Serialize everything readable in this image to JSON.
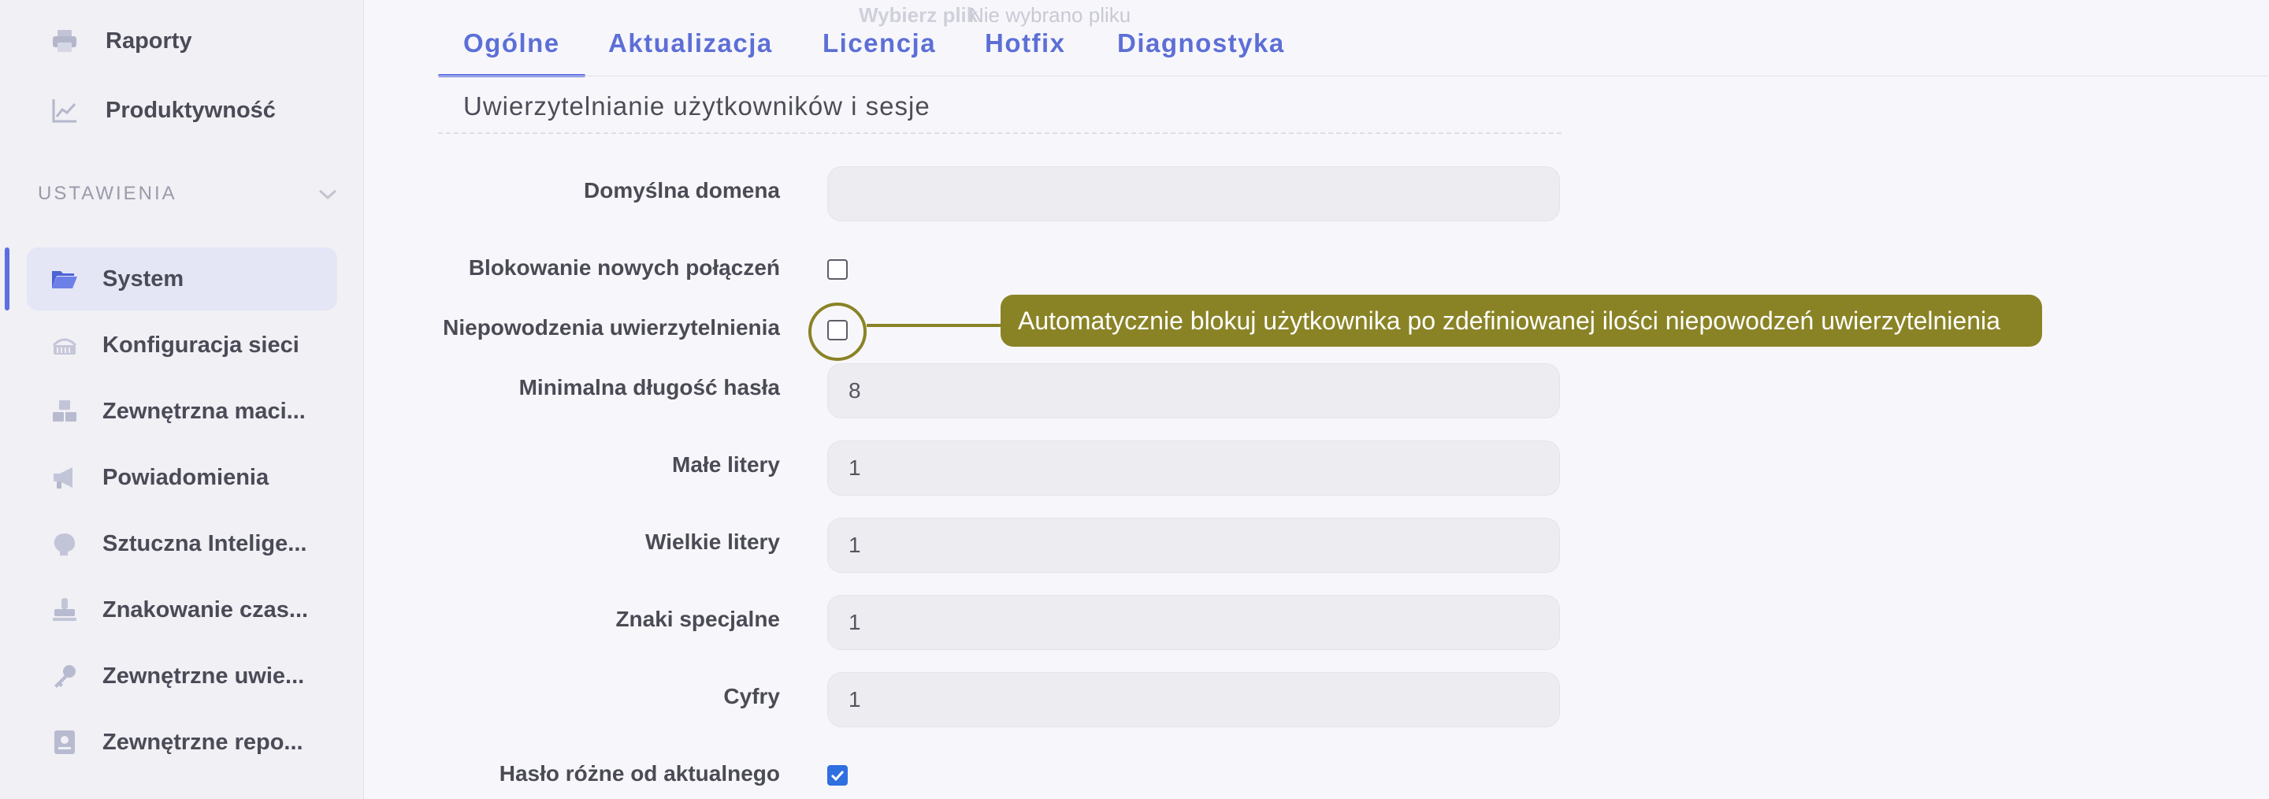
{
  "sidebar": {
    "top_items": [
      {
        "label": "Raporty",
        "icon": "printer-icon"
      },
      {
        "label": "Produktywność",
        "icon": "chart-icon"
      }
    ],
    "section_heading": "USTAWIENIA",
    "items": [
      {
        "label": "System",
        "icon": "folder-icon",
        "active": true
      },
      {
        "label": "Konfiguracja sieci",
        "icon": "network-icon"
      },
      {
        "label": "Zewnętrzna maci...",
        "icon": "boxes-icon"
      },
      {
        "label": "Powiadomienia",
        "icon": "megaphone-icon"
      },
      {
        "label": "Sztuczna Intelige...",
        "icon": "brain-icon"
      },
      {
        "label": "Znakowanie czas...",
        "icon": "stamp-icon"
      },
      {
        "label": "Zewnętrzne uwie...",
        "icon": "key-icon"
      },
      {
        "label": "Zewnętrzne repo...",
        "icon": "repository-icon"
      }
    ]
  },
  "background": {
    "choose_file": "Wybierz plik",
    "no_file": "Nie wybrano pliku"
  },
  "tabs": [
    "Ogólne",
    "Aktualizacja",
    "Licencja",
    "Hotfix",
    "Diagnostyka"
  ],
  "active_tab": "Ogólne",
  "section_title": "Uwierzytelnianie użytkowników i sesje",
  "form": {
    "default_domain_label": "Domyślna domena",
    "default_domain_value": "",
    "block_new_connections_label": "Blokowanie nowych połączeń",
    "block_new_connections_checked": false,
    "auth_failures_label": "Niepowodzenia uwierzytelnienia",
    "auth_failures_checked": false,
    "min_password_length_label": "Minimalna długość hasła",
    "min_password_length_value": "8",
    "lowercase_label": "Małe litery",
    "lowercase_value": "1",
    "uppercase_label": "Wielkie litery",
    "uppercase_value": "1",
    "special_chars_label": "Znaki specjalne",
    "special_chars_value": "1",
    "digits_label": "Cyfry",
    "digits_value": "1",
    "password_differs_label": "Hasło różne od aktualnego",
    "password_differs_checked": true
  },
  "tooltip": "Automatycznie blokuj użytkownika po zdefiniowanej ilości niepowodzeń uwierzytelnienia",
  "colors": {
    "accent": "#5b6fe0",
    "highlight": "#8a8326",
    "checkbox_checked": "#2f6fe0"
  }
}
